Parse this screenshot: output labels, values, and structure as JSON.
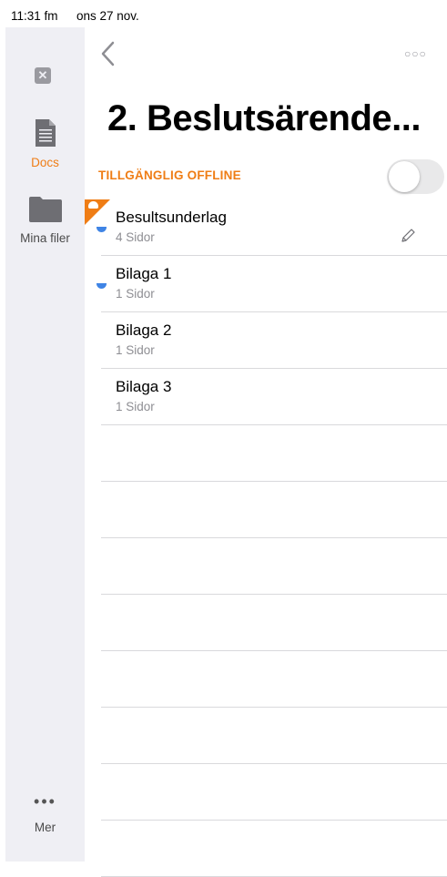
{
  "status": {
    "time": "11:31 fm",
    "date": "ons 27 nov."
  },
  "sidebar": {
    "items": [
      {
        "label": "Docs"
      },
      {
        "label": "Mina filer"
      }
    ],
    "more_label": "Mer"
  },
  "header": {
    "title": "2. Beslutsärende..."
  },
  "offline": {
    "label": "TILLGÄNGLIG OFFLINE",
    "enabled": false
  },
  "documents": [
    {
      "name": "Besultsunderlag",
      "pages": "4 Sidor"
    },
    {
      "name": "Bilaga 1",
      "pages": "1 Sidor"
    },
    {
      "name": "Bilaga 2",
      "pages": "1 Sidor"
    },
    {
      "name": "Bilaga 3",
      "pages": "1 Sidor"
    }
  ],
  "colors": {
    "accent": "#ef7d15",
    "unread_dot": "#3f84e5",
    "sidebar_bg": "#efeff4"
  }
}
